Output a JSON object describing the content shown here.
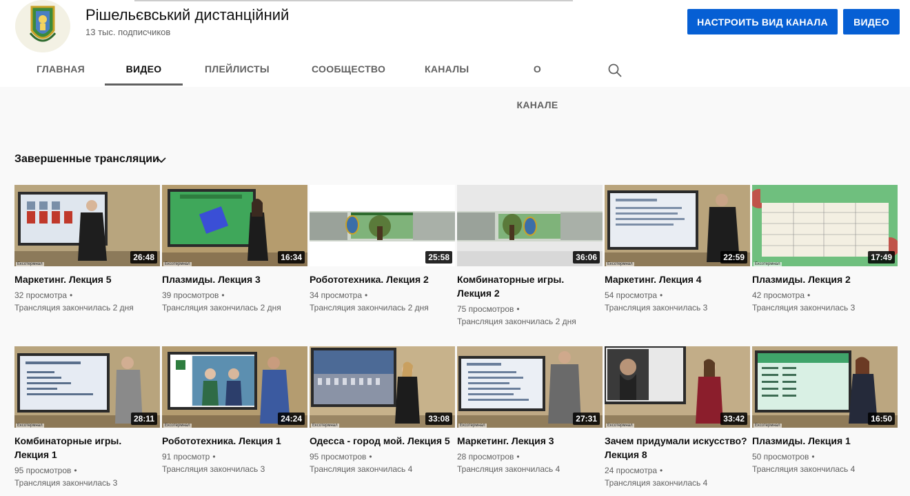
{
  "channel": {
    "name": "Рішельєвський дистанційний",
    "subscribers": "13 тыс. подписчиков",
    "customize_label": "НАСТРОИТЬ ВИД КАНАЛА",
    "video_label": "ВИДЕО"
  },
  "tabs": [
    {
      "label": "ГЛАВНАЯ"
    },
    {
      "label": "ВИДЕО"
    },
    {
      "label": "ПЛЕЙЛИСТЫ"
    },
    {
      "label": "СООБЩЕСТВО"
    },
    {
      "label": "КАНАЛЫ"
    },
    {
      "label": "О КАНАЛЕ"
    }
  ],
  "search_icon": "search-icon",
  "section": {
    "title": "Завершенные трансляции",
    "icon": "chevron-down-icon"
  },
  "videos": [
    {
      "title": "Маркетинг. Лекция 5",
      "views": "32 просмотра",
      "dot": "•",
      "status": "Трансляция закончилась 2 дня",
      "duration": "26:48"
    },
    {
      "title": "Плазмиды. Лекция 3",
      "views": "39 просмотров",
      "dot": "•",
      "status": "Трансляция закончилась 2 дня",
      "duration": "16:34"
    },
    {
      "title": "Робототехника. Лекция 2",
      "views": "34 просмотра",
      "dot": "•",
      "status": "Трансляция закончилась 2 дня",
      "duration": "25:58"
    },
    {
      "title": "Комбинаторные игры. Лекция 2",
      "views": "75 просмотров",
      "dot": "•",
      "status": "Трансляция закончилась 2 дня",
      "duration": "36:06"
    },
    {
      "title": "Маркетинг. Лекция 4",
      "views": "54 просмотра",
      "dot": "•",
      "status": "Трансляция закончилась 3",
      "duration": "22:59"
    },
    {
      "title": "Плазмиды. Лекция 2",
      "views": "42 просмотра",
      "dot": "•",
      "status": "Трансляция закончилась 3",
      "duration": "17:49"
    },
    {
      "title": "Комбинаторные игры. Лекция 1",
      "views": "95 просмотров",
      "dot": "•",
      "status": "Трансляция закончилась 3",
      "duration": "28:11"
    },
    {
      "title": "Робототехника. Лекция 1",
      "views": "91 просмотр",
      "dot": "•",
      "status": "Трансляция закончилась 3",
      "duration": "24:24"
    },
    {
      "title": "Одесса - город мой. Лекция 5",
      "views": "95 просмотров",
      "dot": "•",
      "status": "Трансляция закончилась 4",
      "duration": "33:08"
    },
    {
      "title": "Маркетинг. Лекция 3",
      "views": "28 просмотров",
      "dot": "•",
      "status": "Трансляция закончилась 4",
      "duration": "27:31"
    },
    {
      "title": "Зачем придумали искусство? Лекция 8",
      "views": "24 просмотра",
      "dot": "•",
      "status": "Трансляция закончилась 4",
      "duration": "33:42"
    },
    {
      "title": "Плазмиды. Лекция 1",
      "views": "50 просмотров",
      "dot": "•",
      "status": "Трансляция закончилась 4",
      "duration": "16:50"
    }
  ]
}
